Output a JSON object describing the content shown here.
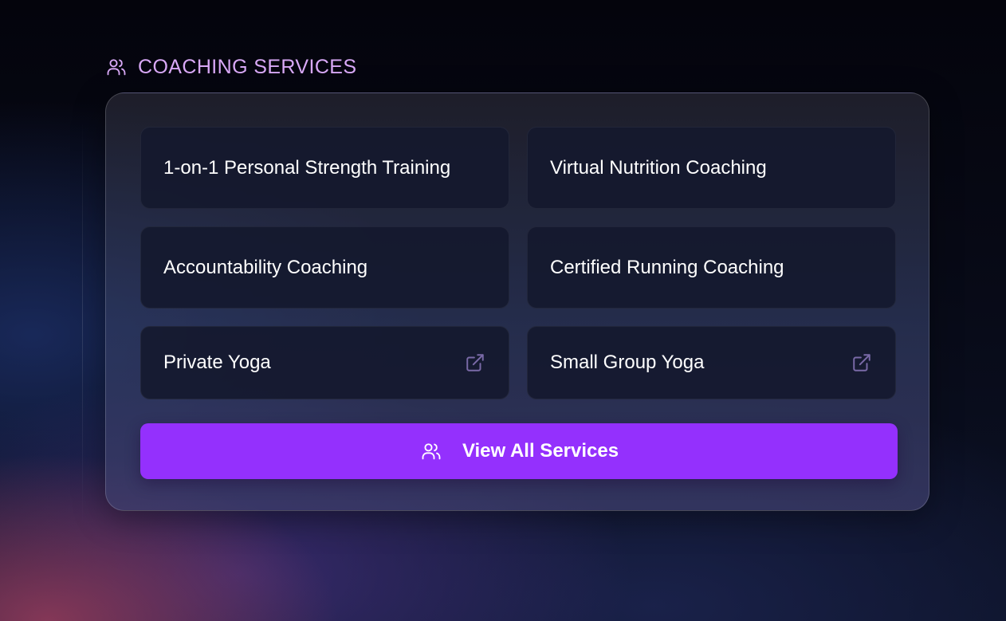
{
  "header": {
    "icon": "users-icon",
    "title": "COACHING SERVICES"
  },
  "services": [
    {
      "label": "1-on-1 Personal Strength Training",
      "external": false
    },
    {
      "label": "Virtual Nutrition Coaching",
      "external": false
    },
    {
      "label": "Accountability Coaching",
      "external": false
    },
    {
      "label": "Certified Running Coaching",
      "external": false
    },
    {
      "label": "Private Yoga",
      "external": true,
      "icon": "external-link-icon"
    },
    {
      "label": "Small Group Yoga",
      "external": true,
      "icon": "external-link-icon"
    }
  ],
  "cta": {
    "icon": "users-icon",
    "label": "View All Services"
  },
  "colors": {
    "accent": "#9430fd",
    "header_text": "#d9a9f7",
    "tile_bg": "#14182e",
    "icon_muted": "#7a6aa8"
  }
}
